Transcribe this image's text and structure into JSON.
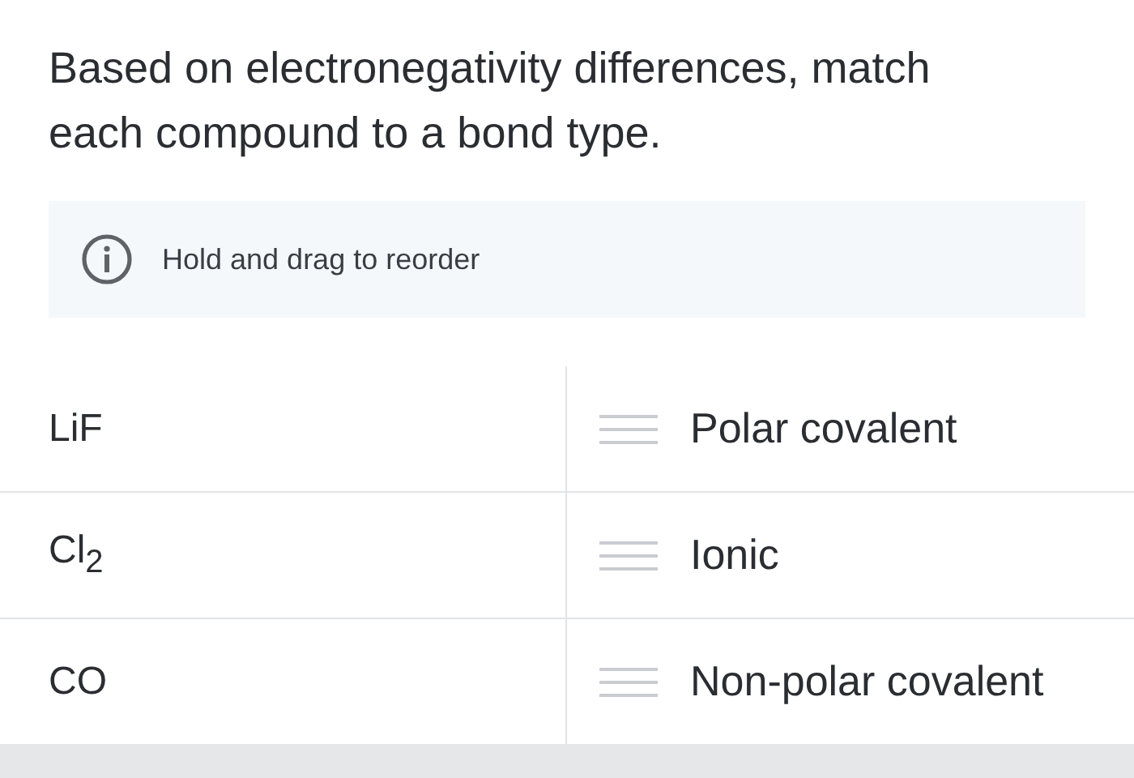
{
  "question": "Based on electronegativity differences, match each compound to a bond type.",
  "hint": {
    "text": "Hold and drag to reorder"
  },
  "rows": [
    {
      "compound": "LiF",
      "answer": "Polar covalent"
    },
    {
      "compound": "Cl$_{2}$",
      "answer": "Ionic"
    },
    {
      "compound": "CO",
      "answer": "Non-polar covalent"
    }
  ]
}
